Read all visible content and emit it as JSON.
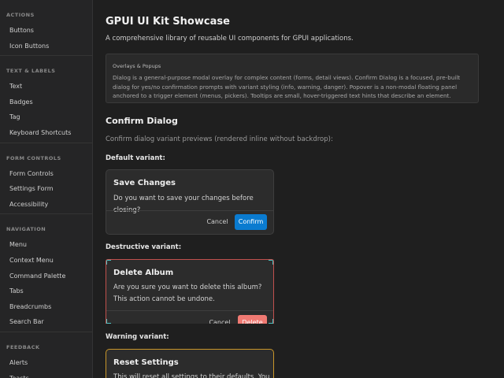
{
  "sidebar": {
    "sections": [
      {
        "header": "ACTIONS",
        "items": [
          "Buttons",
          "Icon Buttons"
        ]
      },
      {
        "header": "TEXT & LABELS",
        "items": [
          "Text",
          "Badges",
          "Tag",
          "Keyboard Shortcuts"
        ]
      },
      {
        "header": "FORM CONTROLS",
        "items": [
          "Form Controls",
          "Settings Form",
          "Accessibility"
        ]
      },
      {
        "header": "NAVIGATION",
        "items": [
          "Menu",
          "Context Menu",
          "Command Palette",
          "Tabs",
          "Breadcrumbs",
          "Search Bar"
        ]
      },
      {
        "header": "FEEDBACK",
        "items": [
          "Alerts",
          "Toasts"
        ]
      }
    ]
  },
  "main": {
    "title": "GPUI UI Kit Showcase",
    "subtitle": "A comprehensive library of reusable UI components for GPUI applications.",
    "info": {
      "title": "Overlays & Popups",
      "text": "Dialog is a general-purpose modal overlay for complex content (forms, detail views). Confirm Dialog is a focused, pre-built dialog for yes/no confirmation prompts with variant styling (info, warning, danger). Popover is a non-modal floating panel anchored to a trigger element (menus, pickers). Tooltips are small, hover-triggered text hints that describe an element."
    },
    "section_title": "Confirm Dialog",
    "section_desc": "Confirm dialog variant previews (rendered inline without backdrop):",
    "variants": {
      "default": {
        "label": "Default variant:",
        "title": "Save Changes",
        "message": "Do you want to save your changes before closing?",
        "cancel": "Cancel",
        "confirm": "Confirm"
      },
      "destructive": {
        "label": "Destructive variant:",
        "title": "Delete Album",
        "message": "Are you sure you want to delete this album? This action cannot be undone.",
        "cancel": "Cancel",
        "confirm": "Delete"
      },
      "warning": {
        "label": "Warning variant:",
        "title": "Reset Settings",
        "message": "This will reset all settings to their defaults. You"
      }
    }
  },
  "colors": {
    "background": "#1f1f1f",
    "sidebar": "#252526",
    "primary": "#0a7bd0",
    "danger": "#f07a73",
    "destructive_border": "#c0504d",
    "warning_border": "#c9962a"
  }
}
